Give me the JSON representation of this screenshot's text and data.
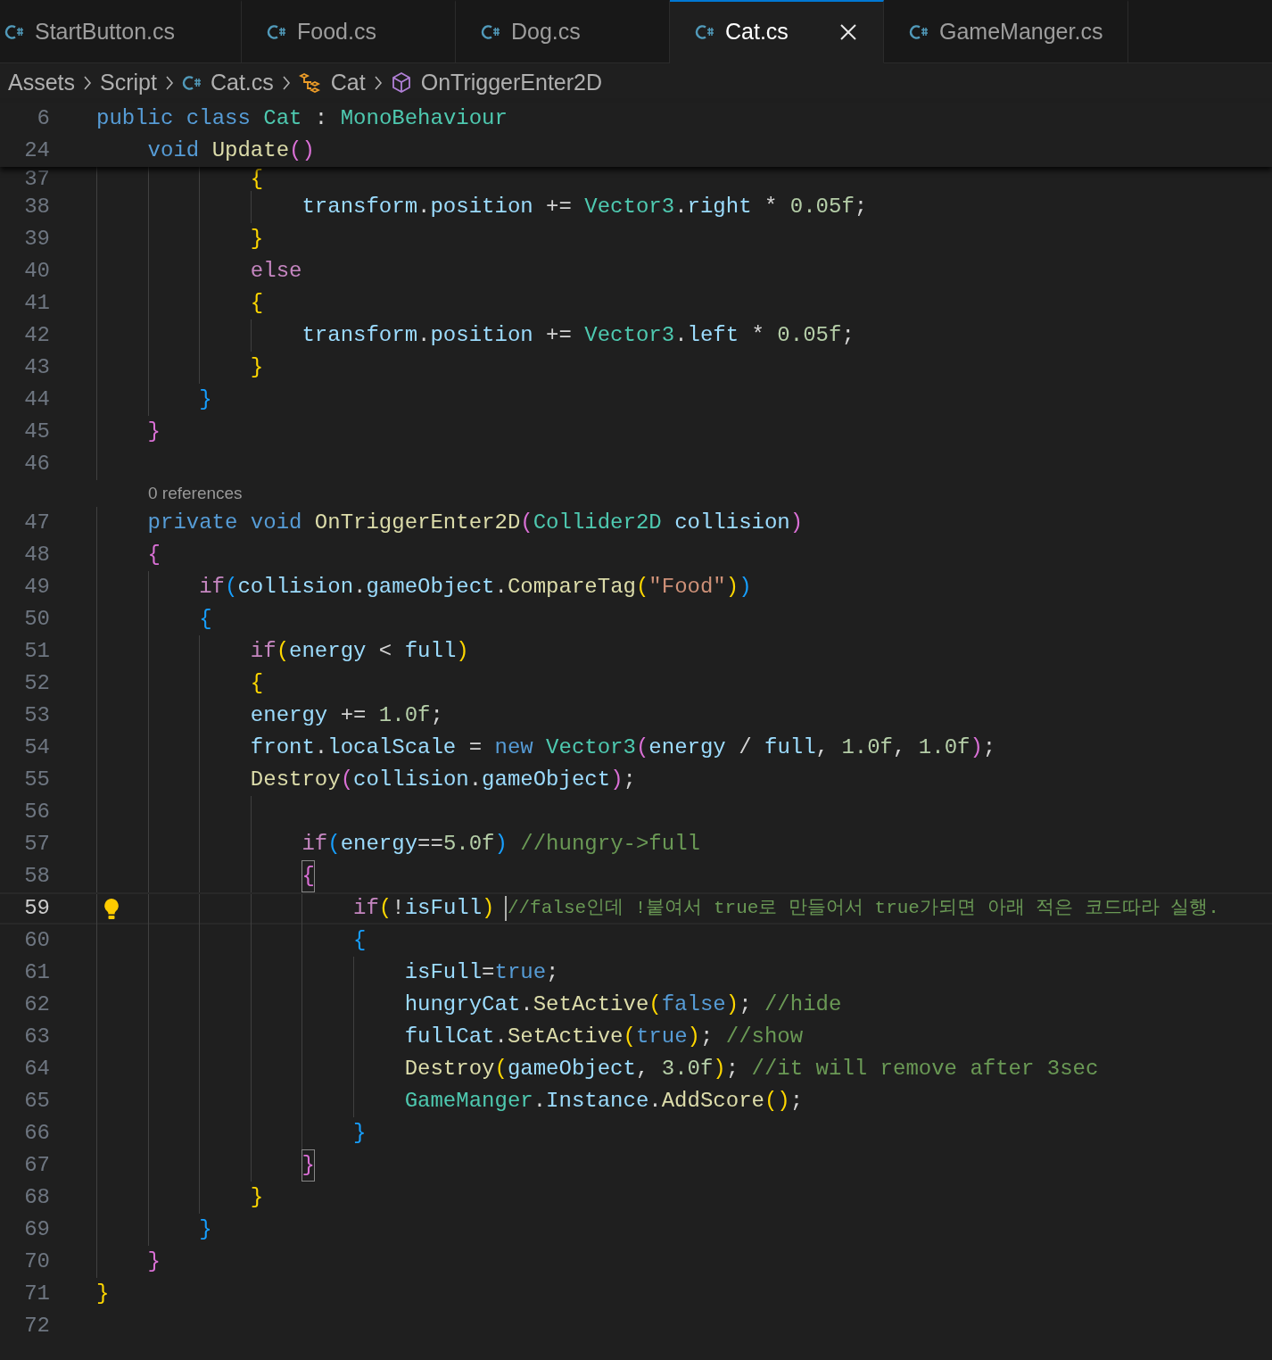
{
  "tabs": [
    {
      "label": "StartButton.cs",
      "selected": false
    },
    {
      "label": "Food.cs",
      "selected": false
    },
    {
      "label": "Dog.cs",
      "selected": false
    },
    {
      "label": "Cat.cs",
      "selected": true
    },
    {
      "label": "GameManger.cs",
      "selected": false
    }
  ],
  "breadcrumb": [
    {
      "kind": "folder",
      "label": "Assets"
    },
    {
      "kind": "folder",
      "label": "Script"
    },
    {
      "kind": "file",
      "label": "Cat.cs"
    },
    {
      "kind": "class",
      "label": "Cat"
    },
    {
      "kind": "method",
      "label": "OnTriggerEnter2D"
    }
  ],
  "sticky_scroll": [
    {
      "number": "6",
      "current": false,
      "tokens": [
        {
          "kind": "kw",
          "text": "public "
        },
        {
          "kind": "kw",
          "text": "class "
        },
        {
          "kind": "type",
          "text": "Cat"
        },
        {
          "kind": "p",
          "text": " : "
        },
        {
          "kind": "type",
          "text": "MonoBehaviour"
        }
      ]
    },
    {
      "number": "24",
      "current": false,
      "tokens": [
        {
          "kind": "kw",
          "text": "    void "
        },
        {
          "kind": "fn",
          "text": "Update"
        },
        {
          "kind": "b2",
          "text": "()"
        }
      ]
    }
  ],
  "lines": [
    {
      "kind": "code",
      "number": "37",
      "current": false,
      "tokens": [
        {
          "kind": "b1",
          "text": "            {"
        }
      ]
    },
    {
      "kind": "code",
      "number": "38",
      "current": false,
      "tokens": [
        {
          "kind": "var",
          "text": "                transform"
        },
        {
          "kind": "p",
          "text": "."
        },
        {
          "kind": "var",
          "text": "position"
        },
        {
          "kind": "p",
          "text": " += "
        },
        {
          "kind": "type",
          "text": "Vector3"
        },
        {
          "kind": "p",
          "text": "."
        },
        {
          "kind": "var",
          "text": "right"
        },
        {
          "kind": "p",
          "text": " * "
        },
        {
          "kind": "num",
          "text": "0.05f"
        },
        {
          "kind": "p",
          "text": ";"
        }
      ]
    },
    {
      "kind": "code",
      "number": "39",
      "current": false,
      "tokens": [
        {
          "kind": "b1",
          "text": "            }"
        }
      ]
    },
    {
      "kind": "code",
      "number": "40",
      "current": false,
      "tokens": [
        {
          "kind": "ctl",
          "text": "            else"
        }
      ]
    },
    {
      "kind": "code",
      "number": "41",
      "current": false,
      "tokens": [
        {
          "kind": "b1",
          "text": "            {"
        }
      ]
    },
    {
      "kind": "code",
      "number": "42",
      "current": false,
      "tokens": [
        {
          "kind": "var",
          "text": "                transform"
        },
        {
          "kind": "p",
          "text": "."
        },
        {
          "kind": "var",
          "text": "position"
        },
        {
          "kind": "p",
          "text": " += "
        },
        {
          "kind": "type",
          "text": "Vector3"
        },
        {
          "kind": "p",
          "text": "."
        },
        {
          "kind": "var",
          "text": "left"
        },
        {
          "kind": "p",
          "text": " * "
        },
        {
          "kind": "num",
          "text": "0.05f"
        },
        {
          "kind": "p",
          "text": ";"
        }
      ]
    },
    {
      "kind": "code",
      "number": "43",
      "current": false,
      "tokens": [
        {
          "kind": "b1",
          "text": "            }"
        }
      ]
    },
    {
      "kind": "code",
      "number": "44",
      "current": false,
      "tokens": [
        {
          "kind": "b3",
          "text": "        }"
        }
      ]
    },
    {
      "kind": "code",
      "number": "45",
      "current": false,
      "tokens": [
        {
          "kind": "b2",
          "text": "    }"
        }
      ]
    },
    {
      "kind": "code",
      "number": "46",
      "current": false
    },
    {
      "kind": "codelens",
      "text": "0 references"
    },
    {
      "kind": "code",
      "number": "47",
      "current": false,
      "tokens": [
        {
          "kind": "kw",
          "text": "    private "
        },
        {
          "kind": "kw",
          "text": "void "
        },
        {
          "kind": "fn",
          "text": "OnTriggerEnter2D"
        },
        {
          "kind": "b2",
          "text": "("
        },
        {
          "kind": "type",
          "text": "Collider2D "
        },
        {
          "kind": "var",
          "text": "collision"
        },
        {
          "kind": "b2",
          "text": ")"
        }
      ]
    },
    {
      "kind": "code",
      "number": "48",
      "current": false,
      "tokens": [
        {
          "kind": "b2",
          "text": "    {"
        }
      ]
    },
    {
      "kind": "code",
      "number": "49",
      "current": false,
      "tokens": [
        {
          "kind": "ctl",
          "text": "        if"
        },
        {
          "kind": "b3",
          "text": "("
        },
        {
          "kind": "var",
          "text": "collision"
        },
        {
          "kind": "p",
          "text": "."
        },
        {
          "kind": "var",
          "text": "gameObject"
        },
        {
          "kind": "p",
          "text": "."
        },
        {
          "kind": "fn",
          "text": "CompareTag"
        },
        {
          "kind": "b1",
          "text": "("
        },
        {
          "kind": "str",
          "text": "\"Food\""
        },
        {
          "kind": "b1",
          "text": ")"
        },
        {
          "kind": "b3",
          "text": ")"
        }
      ]
    },
    {
      "kind": "code",
      "number": "50",
      "current": false,
      "tokens": [
        {
          "kind": "b3",
          "text": "        {"
        }
      ]
    },
    {
      "kind": "code",
      "number": "51",
      "current": false,
      "tokens": [
        {
          "kind": "ctl",
          "text": "            if"
        },
        {
          "kind": "b1",
          "text": "("
        },
        {
          "kind": "var",
          "text": "energy"
        },
        {
          "kind": "p",
          "text": " < "
        },
        {
          "kind": "var",
          "text": "full"
        },
        {
          "kind": "b1",
          "text": ")"
        }
      ]
    },
    {
      "kind": "code",
      "number": "52",
      "current": false,
      "tokens": [
        {
          "kind": "b1",
          "text": "            {"
        }
      ]
    },
    {
      "kind": "code",
      "number": "53",
      "current": false,
      "tokens": [
        {
          "kind": "var",
          "text": "            energy"
        },
        {
          "kind": "p",
          "text": " += "
        },
        {
          "kind": "num",
          "text": "1.0f"
        },
        {
          "kind": "p",
          "text": ";"
        }
      ]
    },
    {
      "kind": "code",
      "number": "54",
      "current": false,
      "tokens": [
        {
          "kind": "var",
          "text": "            front"
        },
        {
          "kind": "p",
          "text": "."
        },
        {
          "kind": "var",
          "text": "localScale"
        },
        {
          "kind": "p",
          "text": " = "
        },
        {
          "kind": "kw",
          "text": "new "
        },
        {
          "kind": "type",
          "text": "Vector3"
        },
        {
          "kind": "b2",
          "text": "("
        },
        {
          "kind": "var",
          "text": "energy"
        },
        {
          "kind": "p",
          "text": " / "
        },
        {
          "kind": "var",
          "text": "full"
        },
        {
          "kind": "p",
          "text": ", "
        },
        {
          "kind": "num",
          "text": "1.0f"
        },
        {
          "kind": "p",
          "text": ", "
        },
        {
          "kind": "num",
          "text": "1.0f"
        },
        {
          "kind": "b2",
          "text": ")"
        },
        {
          "kind": "p",
          "text": ";"
        }
      ]
    },
    {
      "kind": "code",
      "number": "55",
      "current": false,
      "tokens": [
        {
          "kind": "fn",
          "text": "            Destroy"
        },
        {
          "kind": "b2",
          "text": "("
        },
        {
          "kind": "var",
          "text": "collision"
        },
        {
          "kind": "p",
          "text": "."
        },
        {
          "kind": "var",
          "text": "gameObject"
        },
        {
          "kind": "b2",
          "text": ")"
        },
        {
          "kind": "p",
          "text": ";"
        }
      ]
    },
    {
      "kind": "code",
      "number": "56",
      "current": false
    },
    {
      "kind": "code",
      "number": "57",
      "current": false,
      "tokens": [
        {
          "kind": "ctl",
          "text": "                if"
        },
        {
          "kind": "b3",
          "text": "("
        },
        {
          "kind": "var",
          "text": "energy"
        },
        {
          "kind": "p",
          "text": "=="
        },
        {
          "kind": "num",
          "text": "5.0f"
        },
        {
          "kind": "b3",
          "text": ")"
        },
        {
          "kind": "com",
          "text": " //hungry->full"
        }
      ]
    },
    {
      "kind": "code",
      "number": "58",
      "current": false,
      "tokens": [
        {
          "kind": "b2",
          "text": "                {",
          "matched": true
        }
      ]
    },
    {
      "kind": "code",
      "number": "59",
      "current": true,
      "tokens": [
        {
          "kind": "ctl",
          "text": "                    if"
        },
        {
          "kind": "b1",
          "text": "("
        },
        {
          "kind": "p",
          "text": "!"
        },
        {
          "kind": "var",
          "text": "isFull"
        },
        {
          "kind": "b1",
          "text": ") "
        },
        {
          "kind": "com",
          "text": "//false인데 !붙여서 true로 만들어서 true가되면 아래 적은 코드따라 실행.",
          "cursor_before": true
        }
      ]
    },
    {
      "kind": "code",
      "number": "60",
      "current": false,
      "tokens": [
        {
          "kind": "b3",
          "text": "                    {"
        }
      ]
    },
    {
      "kind": "code",
      "number": "61",
      "current": false,
      "tokens": [
        {
          "kind": "var",
          "text": "                        isFull"
        },
        {
          "kind": "p",
          "text": "="
        },
        {
          "kind": "kw",
          "text": "true"
        },
        {
          "kind": "p",
          "text": ";"
        }
      ]
    },
    {
      "kind": "code",
      "number": "62",
      "current": false,
      "tokens": [
        {
          "kind": "var",
          "text": "                        hungryCat"
        },
        {
          "kind": "p",
          "text": "."
        },
        {
          "kind": "fn",
          "text": "SetActive"
        },
        {
          "kind": "b1",
          "text": "("
        },
        {
          "kind": "kw",
          "text": "false"
        },
        {
          "kind": "b1",
          "text": ")"
        },
        {
          "kind": "p",
          "text": "; "
        },
        {
          "kind": "com",
          "text": "//hide"
        }
      ]
    },
    {
      "kind": "code",
      "number": "63",
      "current": false,
      "tokens": [
        {
          "kind": "var",
          "text": "                        fullCat"
        },
        {
          "kind": "p",
          "text": "."
        },
        {
          "kind": "fn",
          "text": "SetActive"
        },
        {
          "kind": "b1",
          "text": "("
        },
        {
          "kind": "kw",
          "text": "true"
        },
        {
          "kind": "b1",
          "text": ")"
        },
        {
          "kind": "p",
          "text": "; "
        },
        {
          "kind": "com",
          "text": "//show"
        }
      ]
    },
    {
      "kind": "code",
      "number": "64",
      "current": false,
      "tokens": [
        {
          "kind": "fn",
          "text": "                        Destroy"
        },
        {
          "kind": "b1",
          "text": "("
        },
        {
          "kind": "var",
          "text": "gameObject"
        },
        {
          "kind": "p",
          "text": ", "
        },
        {
          "kind": "num",
          "text": "3.0f"
        },
        {
          "kind": "b1",
          "text": ")"
        },
        {
          "kind": "p",
          "text": "; "
        },
        {
          "kind": "com",
          "text": "//it will remove after 3sec"
        }
      ]
    },
    {
      "kind": "code",
      "number": "65",
      "current": false,
      "tokens": [
        {
          "kind": "type",
          "text": "                        GameManger"
        },
        {
          "kind": "p",
          "text": "."
        },
        {
          "kind": "var",
          "text": "Instance"
        },
        {
          "kind": "p",
          "text": "."
        },
        {
          "kind": "fn",
          "text": "AddScore"
        },
        {
          "kind": "b1",
          "text": "()"
        },
        {
          "kind": "p",
          "text": ";"
        }
      ]
    },
    {
      "kind": "code",
      "number": "66",
      "current": false,
      "tokens": [
        {
          "kind": "b3",
          "text": "                    }"
        }
      ]
    },
    {
      "kind": "code",
      "number": "67",
      "current": false,
      "tokens": [
        {
          "kind": "b2",
          "text": "                }",
          "matched": true
        }
      ]
    },
    {
      "kind": "code",
      "number": "68",
      "current": false,
      "tokens": [
        {
          "kind": "b1",
          "text": "            }"
        }
      ]
    },
    {
      "kind": "code",
      "number": "69",
      "current": false,
      "tokens": [
        {
          "kind": "b3",
          "text": "        }"
        }
      ]
    },
    {
      "kind": "code",
      "number": "70",
      "current": false,
      "tokens": [
        {
          "kind": "b2",
          "text": "    }"
        }
      ]
    },
    {
      "kind": "code",
      "number": "71",
      "current": false,
      "tokens": [
        {
          "kind": "b1",
          "text": "}"
        }
      ]
    },
    {
      "kind": "code",
      "number": "72",
      "current": false
    }
  ]
}
